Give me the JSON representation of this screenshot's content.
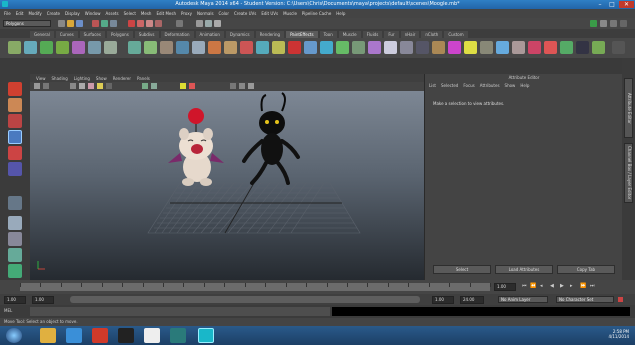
{
  "window": {
    "title": "Autodesk Maya 2014 x64 - Student Version: C:\\Users\\Chris\\Documents\\maya\\projects\\default\\scenes\\Moogle.mb*",
    "minimize": "–",
    "maximize": "□",
    "close": "✕"
  },
  "menubar": [
    "File",
    "Edit",
    "Modify",
    "Create",
    "Display",
    "Window",
    "Assets",
    "Select",
    "Mesh",
    "Edit Mesh",
    "Proxy",
    "Normals",
    "Color",
    "Create UVs",
    "Edit UVs",
    "Muscle",
    "Pipeline Cache",
    "Help"
  ],
  "statusline": {
    "mode": "Polygons"
  },
  "shelf_tabs": [
    "General",
    "Curves",
    "Surfaces",
    "Polygons",
    "Subdivs",
    "Deformation",
    "Animation",
    "Dynamics",
    "Rendering",
    "PaintEffects",
    "Toon",
    "Muscle",
    "Fluids",
    "Fur",
    "nHair",
    "nCloth",
    "Custom"
  ],
  "shelf_active": "PaintEffects",
  "viewport_menu": [
    "View",
    "Shading",
    "Lighting",
    "Show",
    "Renderer",
    "Panels"
  ],
  "attr_editor": {
    "title": "Attribute Editor",
    "menu": [
      "List",
      "Selected",
      "Focus",
      "Attributes",
      "Show",
      "Help"
    ],
    "hint": "Make a selection to view attributes.",
    "buttons": [
      "Select",
      "Load Attributes",
      "Copy Tab"
    ],
    "side_tabs": [
      "Attribute Editor",
      "Channel Box / Layer Editor"
    ]
  },
  "timeline": {
    "start_frame": "1.00",
    "end_frame": "24.00",
    "current_frame": "1.00",
    "range_start": "1.00",
    "range_inner_start": "1.00",
    "range_end": "24.00",
    "anim_layer": "No Anim Layer",
    "char_set": "No Character Set"
  },
  "cmdline": {
    "label": "MEL"
  },
  "helpline": {
    "text": "Move Tool: Select an object to move."
  },
  "taskbar": {
    "time": "2:58 PM",
    "date": "4/11/2014"
  },
  "colors": {
    "accent": "#2f7fc5",
    "viewport_top": "#7d8794",
    "viewport_bottom": "#252a30"
  }
}
